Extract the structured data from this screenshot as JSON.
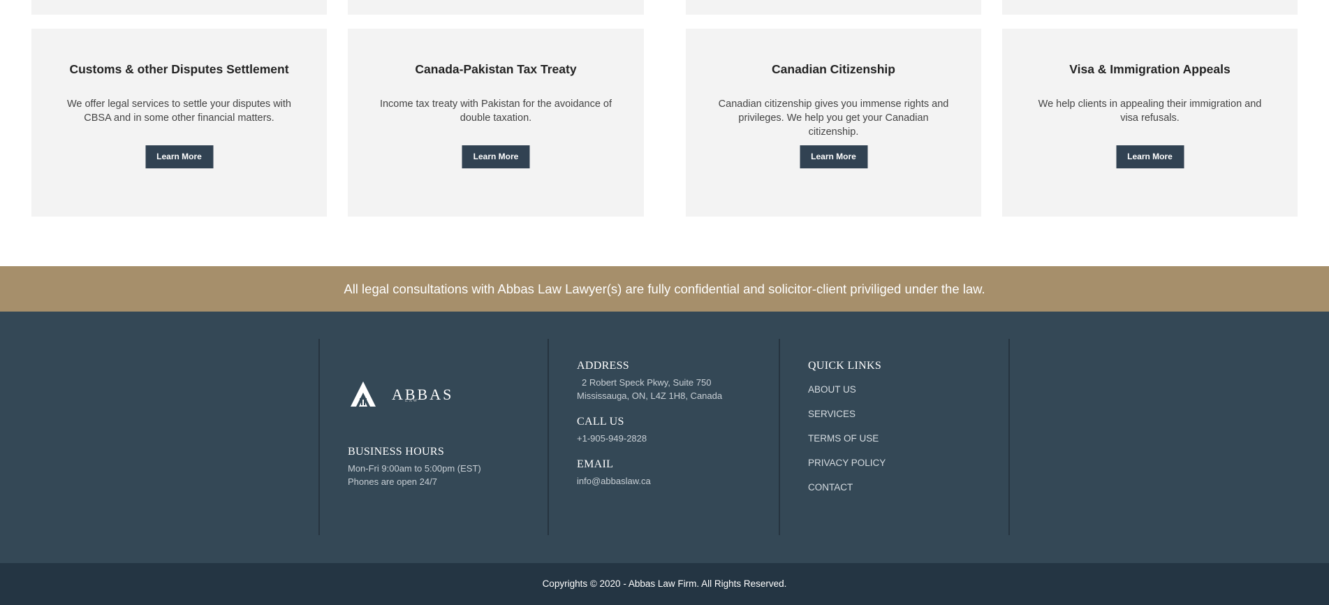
{
  "services": [
    {
      "title": "Customs & other Disputes Settlement",
      "description": "We offer legal services to settle your disputes with CBSA and in some other financial matters.",
      "button_label": "Learn More"
    },
    {
      "title": "Canada-Pakistan Tax Treaty",
      "description": "Income tax treaty with Pakistan for the avoidance of double taxation.",
      "button_label": "Learn More"
    },
    {
      "title": "Canadian Citizenship",
      "description": "Canadian citizenship gives you immense rights and privileges. We help you get your Canadian citizenship.",
      "button_label": "Learn More"
    },
    {
      "title": "Visa & Immigration Appeals",
      "description": "We help clients in appealing their immigration and visa refusals.",
      "button_label": "Learn More"
    }
  ],
  "banner": {
    "text": "All legal consultations with Abbas Law Lawyer(s) are fully confidential and solicitor-client priviliged under the law."
  },
  "footer": {
    "logo": {
      "name": "ABBAS",
      "sub": "LAW"
    },
    "business_hours": {
      "heading": "BUSINESS HOURS",
      "line1": "Mon-Fri 9:00am to 5:00pm (EST)",
      "line2": "Phones are open 24/7"
    },
    "address": {
      "heading": "ADDRESS",
      "line1": "2 Robert Speck Pkwy, Suite 750",
      "line2": "Mississauga, ON, L4Z 1H8, Canada"
    },
    "call": {
      "heading": "CALL US",
      "phone": "+1-905-949-2828"
    },
    "email": {
      "heading": "EMAIL",
      "address": "info@abbaslaw.ca"
    },
    "quick_links": {
      "heading": "QUICK LINKS",
      "items": [
        "ABOUT US",
        "SERVICES",
        "TERMS OF USE",
        "PRIVACY POLICY",
        "CONTACT"
      ]
    }
  },
  "copyright": "Copyrights © 2020 - Abbas Law Firm. All Rights Reserved.",
  "colors": {
    "card_bg": "#f3f3f3",
    "button_bg": "#314252",
    "banner_bg": "#a68f6b",
    "footer_bg": "#344856",
    "copyright_bg": "#243543"
  }
}
